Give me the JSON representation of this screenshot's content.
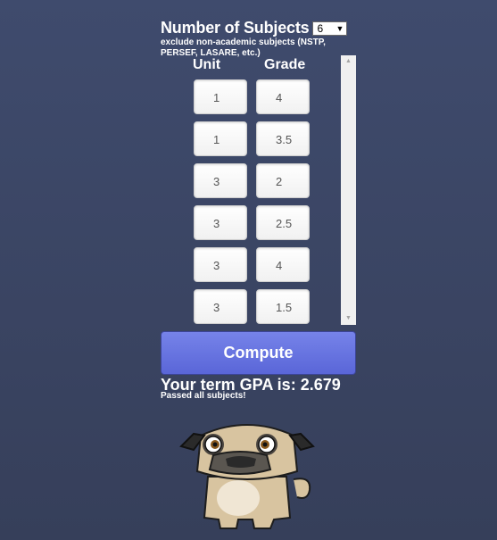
{
  "subjects": {
    "label": "Number of Subjects",
    "selected": "6"
  },
  "note": "exclude non-academic subjects (NSTP, PERSEF, LASARE, etc.)",
  "columns": {
    "unit": "Unit",
    "grade": "Grade"
  },
  "rows": [
    {
      "unit": "1",
      "grade": "4"
    },
    {
      "unit": "1",
      "grade": "3.5"
    },
    {
      "unit": "3",
      "grade": "2"
    },
    {
      "unit": "3",
      "grade": "2.5"
    },
    {
      "unit": "3",
      "grade": "4"
    },
    {
      "unit": "3",
      "grade": "1.5"
    }
  ],
  "compute_label": "Compute",
  "result": {
    "gpa_text": "Your term GPA is: 2.679",
    "status": "Passed all subjects!"
  },
  "icons": {
    "select_arrow": "triangle-down-icon",
    "scroll_up": "triangle-up-icon",
    "scroll_down": "triangle-down-icon",
    "mascot": "pug-mascot"
  },
  "colors": {
    "background": "#3a4564",
    "button": "#6672e0"
  }
}
